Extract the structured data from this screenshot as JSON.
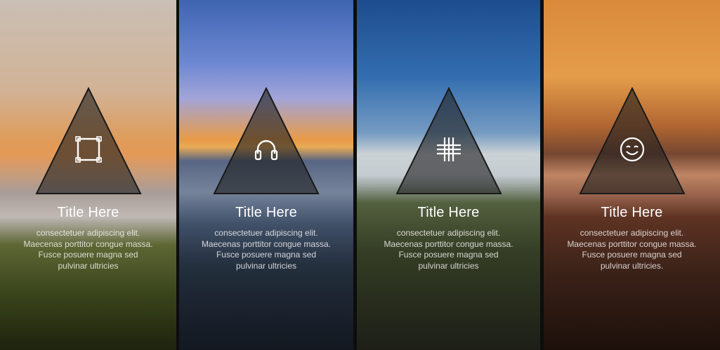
{
  "panels": [
    {
      "icon": "square-selection-icon",
      "title": "Title Here",
      "lines": [
        "consectetuer adipiscing elit.",
        "Maecenas porttitor congue massa.",
        "Fusce posuere magna sed",
        "pulvinar ultricies"
      ]
    },
    {
      "icon": "headphones-icon",
      "title": "Title Here",
      "lines": [
        "consectetuer adipiscing elit.",
        "Maecenas porttitor congue massa.",
        "Fusce posuere magna sed",
        "pulvinar ultricies"
      ]
    },
    {
      "icon": "grid-hash-icon",
      "title": "Title Here",
      "lines": [
        "consectetuer adipiscing elit.",
        "Maecenas porttitor congue massa.",
        "Fusce posuere magna sed",
        "pulvinar ultricies"
      ]
    },
    {
      "icon": "smiley-face-icon",
      "title": "Title Here",
      "lines": [
        "consectetuer adipiscing elit.",
        "Maecenas porttitor congue massa.",
        "Fusce posuere magna sed",
        "pulvinar ultricies."
      ]
    }
  ]
}
